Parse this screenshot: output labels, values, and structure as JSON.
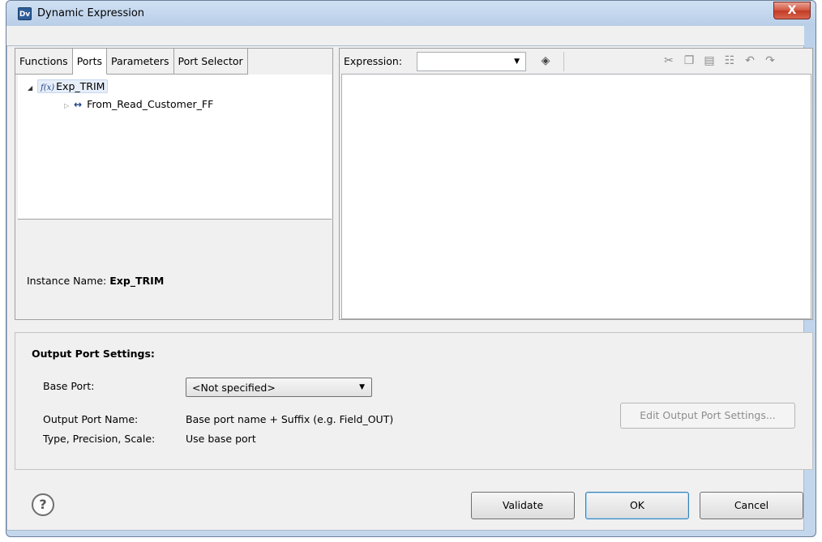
{
  "window": {
    "title": "Dynamic Expression",
    "app_icon": "Dv",
    "close_glyph": "X"
  },
  "tabs": [
    {
      "label": "Functions",
      "active": false
    },
    {
      "label": "Ports",
      "active": true
    },
    {
      "label": "Parameters",
      "active": false
    },
    {
      "label": "Port Selector",
      "active": false
    }
  ],
  "tree": {
    "root_label": "Exp_TRIM",
    "child_label": "From_Read_Customer_FF"
  },
  "instance": {
    "label": "Instance Name:",
    "value": "Exp_TRIM"
  },
  "expression": {
    "label": "Expression:",
    "combo_value": ""
  },
  "output_port_settings": {
    "title": "Output Port Settings:",
    "base_port_label": "Base Port:",
    "base_port_value": "<Not specified>",
    "output_port_name_label": "Output Port Name:",
    "output_port_name_value": "Base port name + Suffix (e.g. Field_OUT)",
    "type_label": "Type, Precision, Scale:",
    "type_value": "Use base port",
    "edit_button": "Edit Output Port Settings..."
  },
  "buttons": {
    "help": "?",
    "validate": "Validate",
    "ok": "OK",
    "cancel": "Cancel"
  },
  "icons": {
    "function": "function-icon",
    "port_link": "port-link-icon",
    "validate_expression": "validate-expression-icon",
    "cut": "cut-icon",
    "copy": "copy-icon",
    "paste": "paste-icon",
    "format": "format-icon",
    "undo": "undo-icon",
    "redo": "redo-icon"
  }
}
